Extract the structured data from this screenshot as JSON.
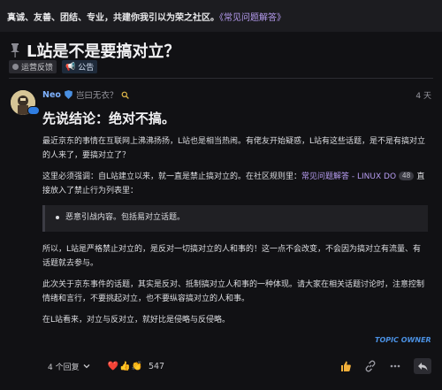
{
  "banner": {
    "text": "真诚、友善、团结、专业，共建你我引以为荣之社区。",
    "faq_link": "《常见问题解答》"
  },
  "topic": {
    "title": "L站是不是要搞对立？",
    "tags": [
      {
        "label": "运营反馈",
        "icon": "circle-dot-icon"
      },
      {
        "label": "公告",
        "icon": "megaphone-icon"
      }
    ]
  },
  "post": {
    "username": "Neo",
    "user_title": "岂曰无衣？",
    "time": "4 天",
    "heading": "先说结论：绝对不搞。",
    "p1": "最近京东的事情在互联网上沸沸扬扬，L站也是相当热闹。有佬友开始疑惑，L站有这些话题，是不是有搞对立的人来了，要搞对立了？",
    "p2_before": "这里必须强调：自L站建立以来，就一直是禁止搞对立的。在社区规则里：",
    "p2_link": "常见问题解答 - LINUX DO",
    "p2_count": "48",
    "p2_after": " 直接放入了禁止行为列表里：",
    "quote_item": "恶意引战内容。包括易对立话题。",
    "p3": "所以，L站是严格禁止对立的，是反对一切搞对立的人和事的！这一点不会改变，不会因为搞对立有流量、有话题就去参与。",
    "p4": "此次关于京东事件的话题，其实是反对、抵制搞对立人和事的一种体现。请大家在相关话题讨论时，注意控制情绪和言行，不要挑起对立，也不要纵容搞对立的人和事。",
    "p5": "在L站看来，对立与反对立，就好比是侵略与反侵略。",
    "topic_owner": "TOPIC OWNER"
  },
  "footer": {
    "replies_label": "4 个回复",
    "reactions": [
      "❤️",
      "👍",
      "👏"
    ],
    "reaction_count": "547",
    "actions": [
      "thumbs-up-icon",
      "link-icon",
      "ellipsis-icon",
      "reply-icon"
    ]
  },
  "colors": {
    "background": "#111114",
    "link": "#b69cf0",
    "username": "#7fb2ff",
    "accent_blue": "#4a90e2"
  }
}
